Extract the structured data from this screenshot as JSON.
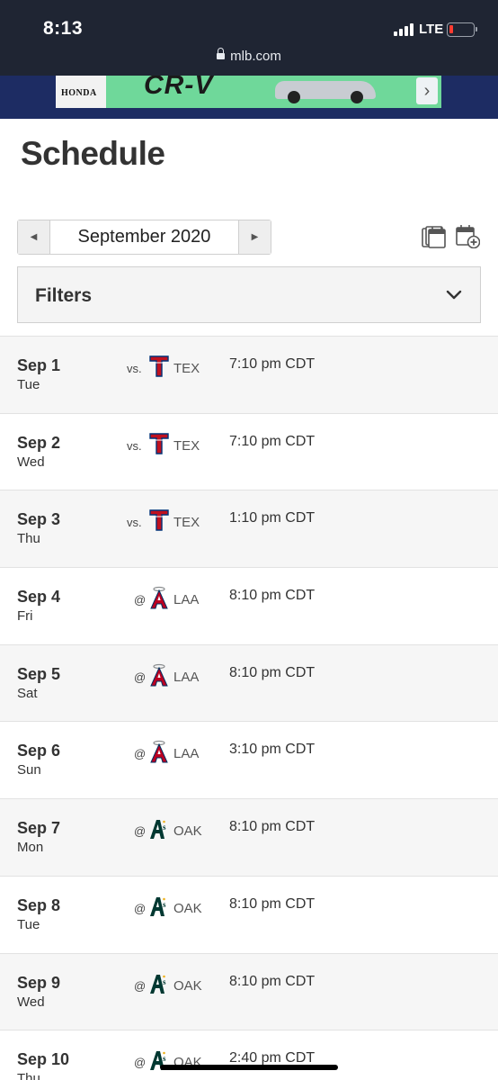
{
  "status_bar": {
    "time": "8:13",
    "network": "LTE",
    "url": "mlb.com"
  },
  "ad": {
    "brand": "HONDA",
    "model": "CR-V",
    "next_label": "›"
  },
  "page": {
    "title": "Schedule"
  },
  "month_nav": {
    "label": "September 2020",
    "prev_icon": "caret-left-icon",
    "next_icon": "caret-right-icon"
  },
  "filters": {
    "label": "Filters",
    "icon": "chevron-down-icon"
  },
  "colors": {
    "status_bar_bg": "#1f2533",
    "ad_strip_bg": "#1d2c63",
    "row_shaded": "#f6f6f6",
    "rangers_red": "#c0111f",
    "rangers_blue": "#003278",
    "angels_red": "#ba0021",
    "athletics_green": "#003831"
  },
  "games": [
    {
      "date": "Sep 1",
      "day": "Tue",
      "home_away": "vs.",
      "team_logo": "rangers-logo-icon",
      "opponent": "TEX",
      "time": "7:10 pm CDT"
    },
    {
      "date": "Sep 2",
      "day": "Wed",
      "home_away": "vs.",
      "team_logo": "rangers-logo-icon",
      "opponent": "TEX",
      "time": "7:10 pm CDT"
    },
    {
      "date": "Sep 3",
      "day": "Thu",
      "home_away": "vs.",
      "team_logo": "rangers-logo-icon",
      "opponent": "TEX",
      "time": "1:10 pm CDT"
    },
    {
      "date": "Sep 4",
      "day": "Fri",
      "home_away": "@",
      "team_logo": "angels-logo-icon",
      "opponent": "LAA",
      "time": "8:10 pm CDT"
    },
    {
      "date": "Sep 5",
      "day": "Sat",
      "home_away": "@",
      "team_logo": "angels-logo-icon",
      "opponent": "LAA",
      "time": "8:10 pm CDT"
    },
    {
      "date": "Sep 6",
      "day": "Sun",
      "home_away": "@",
      "team_logo": "angels-logo-icon",
      "opponent": "LAA",
      "time": "3:10 pm CDT"
    },
    {
      "date": "Sep 7",
      "day": "Mon",
      "home_away": "@",
      "team_logo": "athletics-logo-icon",
      "opponent": "OAK",
      "time": "8:10 pm CDT"
    },
    {
      "date": "Sep 8",
      "day": "Tue",
      "home_away": "@",
      "team_logo": "athletics-logo-icon",
      "opponent": "OAK",
      "time": "8:10 pm CDT"
    },
    {
      "date": "Sep 9",
      "day": "Wed",
      "home_away": "@",
      "team_logo": "athletics-logo-icon",
      "opponent": "OAK",
      "time": "8:10 pm CDT"
    },
    {
      "date": "Sep 10",
      "day": "Thu",
      "home_away": "@",
      "team_logo": "athletics-logo-icon",
      "opponent": "OAK",
      "time": "2:40 pm CDT"
    }
  ]
}
